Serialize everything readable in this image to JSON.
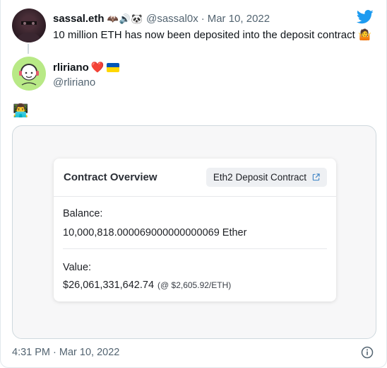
{
  "parent_tweet": {
    "display_name": "sassal.eth",
    "name_emojis": "🦇🔊🐼",
    "handle": "@sassal0x",
    "separator": "·",
    "date": "Mar 10, 2022",
    "text": "10 million ETH has now been deposited into the deposit contract",
    "text_emoji": "🤷"
  },
  "reply": {
    "display_name": "rliriano",
    "heart": "❤️",
    "handle": "@rliriano",
    "body_emoji": "👨‍💻"
  },
  "overview": {
    "title": "Contract Overview",
    "badge_label": "Eth2 Deposit Contract",
    "balance_label": "Balance:",
    "balance_value": "10,000,818.000069000000000069 Ether",
    "value_label": "Value:",
    "value_amount": "$26,061,331,642.74",
    "value_rate": "(@ $2,605.92/ETH)"
  },
  "footer": {
    "timestamp": "4:31 PM · Mar 10, 2022"
  },
  "colors": {
    "twitter_blue": "#1d9bf0",
    "muted": "#536471",
    "heart": "#e0245e",
    "ua_blue": "#0057b7",
    "ua_yellow": "#ffd700"
  },
  "icons": {
    "bird": "twitter-bird-icon",
    "external": "external-link-icon",
    "info": "info-icon"
  }
}
